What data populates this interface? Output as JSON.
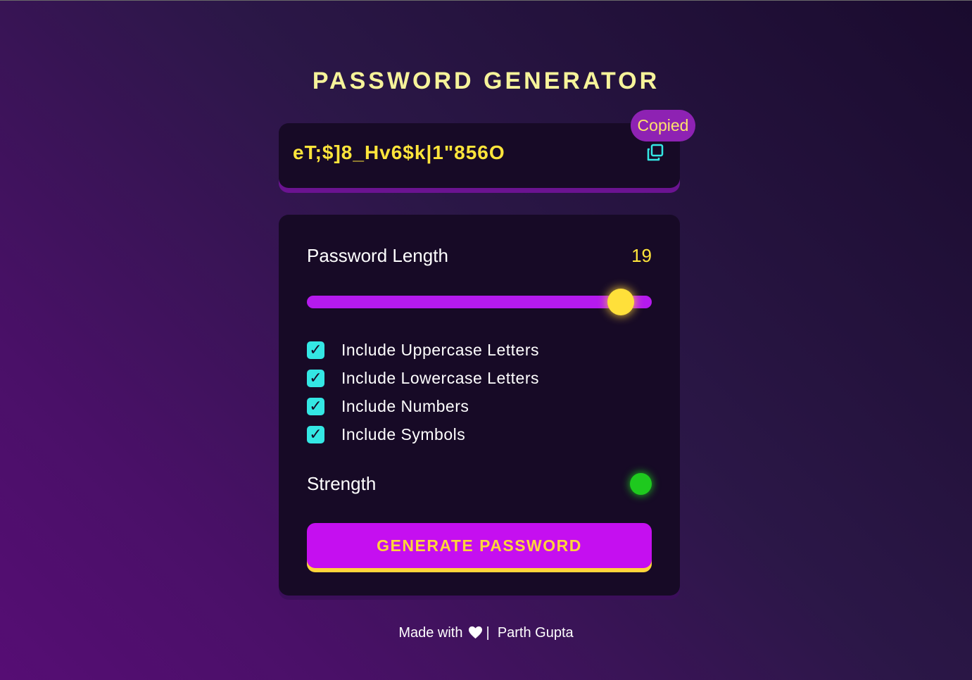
{
  "header": {
    "title": "PASSWORD GENERATOR"
  },
  "display": {
    "password": "eT;$]8_Hv6$k|1\"856O",
    "copy_icon": "copy-icon",
    "copied_label": "Copied"
  },
  "length": {
    "label": "Password Length",
    "value": "19",
    "fraction": 0.91
  },
  "options": [
    {
      "label": "Include Uppercase Letters",
      "checked": true
    },
    {
      "label": "Include Lowercase Letters",
      "checked": true
    },
    {
      "label": "Include Numbers",
      "checked": true
    },
    {
      "label": "Include Symbols",
      "checked": true
    }
  ],
  "strength": {
    "label": "Strength",
    "indicator_color": "#1ec91e"
  },
  "generate_button": {
    "label": "GENERATE PASSWORD"
  },
  "footer": {
    "prefix": "Made with",
    "heart_icon": "heart-icon",
    "separator": "|",
    "author": "Parth Gupta"
  },
  "colors": {
    "accent": "#c50ff0",
    "yellow": "#ffe53b",
    "cyan": "#34e7e4",
    "background": "#2b1747"
  }
}
